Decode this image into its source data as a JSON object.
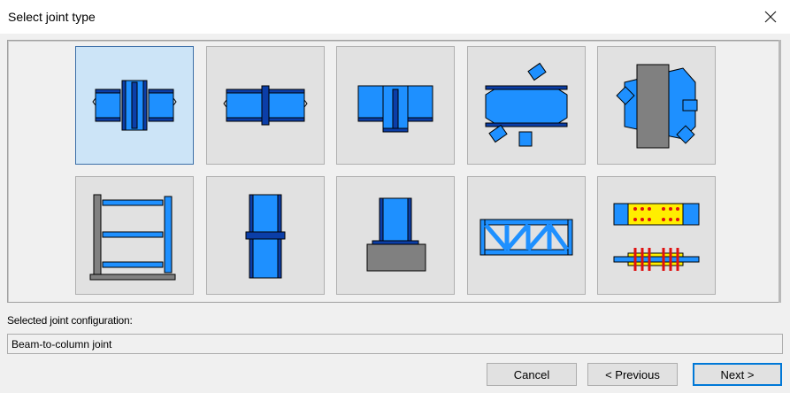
{
  "dialog": {
    "title": "Select joint type"
  },
  "tiles": [
    {
      "name": "beam-to-column-joint",
      "selected": true
    },
    {
      "name": "beam-splice-joint",
      "selected": false
    },
    {
      "name": "beam-to-beam-joint",
      "selected": false
    },
    {
      "name": "bracing-to-beam-joint",
      "selected": false
    },
    {
      "name": "bracing-to-column-joint",
      "selected": false
    },
    {
      "name": "frame-joint",
      "selected": false
    },
    {
      "name": "column-splice-joint",
      "selected": false
    },
    {
      "name": "column-base-joint",
      "selected": false
    },
    {
      "name": "truss-joint",
      "selected": false
    },
    {
      "name": "bolted-plate-joint",
      "selected": false
    }
  ],
  "selection": {
    "label": "Selected joint configuration:",
    "value": "Beam-to-column joint"
  },
  "buttons": {
    "cancel": "Cancel",
    "previous": "< Previous",
    "next": "Next >"
  },
  "colors": {
    "steel_blue": "#1e90ff",
    "steel_dark": "#0b3ea8",
    "concrete_gray": "#808080",
    "selected_tile": "#cce4f7",
    "default_button_border": "#0078d7"
  }
}
